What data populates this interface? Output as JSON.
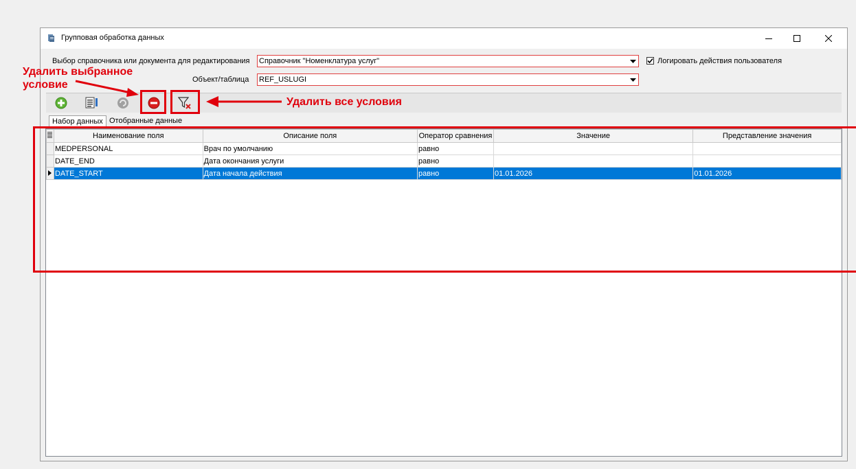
{
  "window": {
    "title": "Групповая обработка данных",
    "controls": {
      "minimize": "minimize-icon",
      "maximize": "maximize-icon",
      "close": "close-icon"
    }
  },
  "form": {
    "source_label": "Выбор справочника или документа для редактирования",
    "source_value": "Справочник \"Номенклатура услуг\"",
    "log_label": "Логировать действия пользователя",
    "log_checked": true,
    "object_label": "Объект/таблица",
    "object_value": "REF_USLUGI"
  },
  "toolbar": {
    "buttons": [
      "add-icon",
      "edit-list-icon",
      "refresh-icon",
      "delete-condition-icon",
      "clear-filter-icon"
    ]
  },
  "tabs": [
    "Набор данных",
    "Отобранные данные"
  ],
  "grid": {
    "columns": [
      "Наименование поля",
      "Описание поля",
      "Оператор сравнения",
      "Значение",
      "Представление значения"
    ],
    "rows": [
      [
        "MEDPERSONAL",
        "Врач по умолчанию",
        "равно",
        "",
        ""
      ],
      [
        "DATE_END",
        "Дата окончания услуги",
        "равно",
        "",
        ""
      ],
      [
        "DATE_START",
        "Дата начала действия",
        "равно",
        "01.01.2026",
        "01.01.2026"
      ]
    ],
    "selected_row": 2
  },
  "annotations": {
    "delete_selected": [
      "Удалить выбранное",
      "условие"
    ],
    "delete_all": "Удалить все условия",
    "color": "#e0000c"
  }
}
